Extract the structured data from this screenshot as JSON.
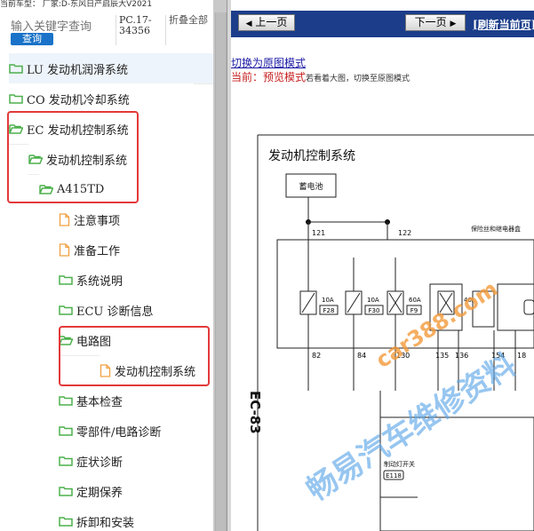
{
  "top_strip": "当前车型：   厂家:D-东风日产启辰大V2021",
  "search": {
    "placeholder": "输入关键字查询",
    "button": "查询",
    "code": "PC.17-34356",
    "fold_all": "折叠全部"
  },
  "tree": [
    {
      "label": "LU 发动机润滑系统",
      "kind": "folder"
    },
    {
      "label": "CO 发动机冷却系统",
      "kind": "folder"
    },
    {
      "label": "EC 发动机控制系统",
      "kind": "folder-open"
    },
    {
      "label": "发动机控制系统",
      "kind": "folder-open"
    },
    {
      "label": "A415TD",
      "kind": "folder-open"
    },
    {
      "label": "注意事项",
      "kind": "file"
    },
    {
      "label": "准备工作",
      "kind": "file"
    },
    {
      "label": "系统说明",
      "kind": "folder"
    },
    {
      "label": "ECU 诊断信息",
      "kind": "folder"
    },
    {
      "label": "电路图",
      "kind": "folder-open"
    },
    {
      "label": "发动机控制系统",
      "kind": "file"
    },
    {
      "label": "基本检查",
      "kind": "folder"
    },
    {
      "label": "零部件/电路诊断",
      "kind": "folder"
    },
    {
      "label": "症状诊断",
      "kind": "folder"
    },
    {
      "label": "定期保养",
      "kind": "folder"
    },
    {
      "label": "拆卸和安装",
      "kind": "folder"
    }
  ],
  "nav": {
    "prev": "上一页",
    "next": "下一页",
    "refresh": "[刷新当前页]"
  },
  "mode": {
    "switch_link": "切换为原图模式",
    "current_label": "当前：",
    "current_mode": "预览模式",
    "hint": "若看着大图，切换至原图模式"
  },
  "diagram": {
    "title": "发动机控制系统",
    "battery": "蓄电池",
    "page_code": "EC-83",
    "relay_box": "保险丝和继电器盒",
    "brake_switch": "制动灯开关",
    "brake_conn": "E118",
    "top_wires": [
      "121",
      "122"
    ],
    "fuses": [
      {
        "amp": "10A",
        "id": "F28"
      },
      {
        "amp": "10A",
        "id": "F30"
      },
      {
        "amp": "60A",
        "id": "F9"
      },
      {
        "amp": "40A",
        "id": ""
      }
    ],
    "bottom_wires": [
      "82",
      "84",
      "130",
      "135",
      "136",
      "154",
      "18"
    ],
    "watermark_url": "car388.com",
    "watermark_text": "畅易汽车维修资料"
  },
  "colors": {
    "nav_bg": "#1b3d8a",
    "highlight": "#e23a3a",
    "button": "#1a73c8",
    "folder": "#4cb04c",
    "file": "#f0a040"
  }
}
